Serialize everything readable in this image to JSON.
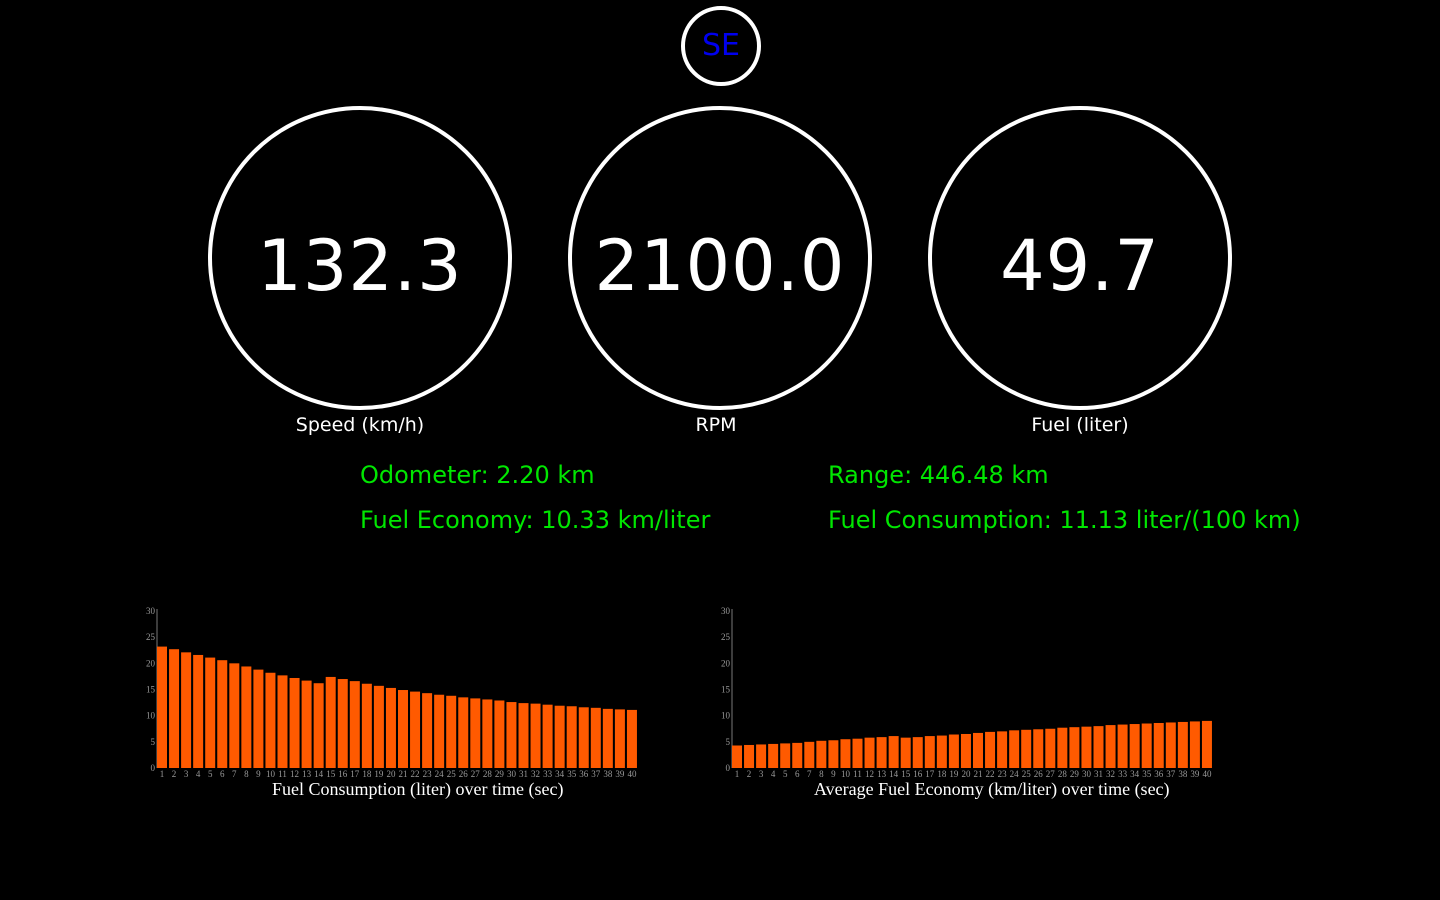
{
  "heading": {
    "text": "SE",
    "color": "#0000ee"
  },
  "gauges": {
    "speed": {
      "value": "132.3",
      "label": "Speed (km/h)"
    },
    "rpm": {
      "value": "2100.0",
      "label": "RPM"
    },
    "fuel": {
      "value": "49.7",
      "label": "Fuel (liter)"
    }
  },
  "stats": {
    "odometer": "Odometer: 2.20 km",
    "fuel_economy": "Fuel Economy: 10.33 km/liter",
    "range": "Range: 446.48 km",
    "fuel_consumption": "Fuel Consumption: 11.13 liter/(100 km)"
  },
  "colors": {
    "stat_text": "#00e600",
    "bars": "#ff5a00",
    "gauge_ring": "#ffffff",
    "background": "#000000"
  },
  "chart_data": [
    {
      "type": "bar",
      "title": "Fuel Consumption (liter) over time (sec)",
      "xlabel": "",
      "ylabel": "",
      "ylim": [
        0,
        30
      ],
      "yticks": [
        0,
        5,
        10,
        15,
        20,
        25,
        30
      ],
      "categories": [
        "1",
        "2",
        "3",
        "4",
        "5",
        "6",
        "7",
        "8",
        "9",
        "10",
        "11",
        "12",
        "13",
        "14",
        "15",
        "16",
        "17",
        "18",
        "19",
        "20",
        "21",
        "22",
        "23",
        "24",
        "25",
        "26",
        "27",
        "28",
        "29",
        "30",
        "31",
        "32",
        "33",
        "34",
        "35",
        "36",
        "37",
        "38",
        "39",
        "40"
      ],
      "values": [
        23.2,
        22.7,
        22.1,
        21.6,
        21.1,
        20.6,
        20.0,
        19.4,
        18.8,
        18.2,
        17.7,
        17.2,
        16.7,
        16.2,
        17.4,
        17.0,
        16.6,
        16.1,
        15.7,
        15.3,
        14.9,
        14.6,
        14.3,
        14.0,
        13.8,
        13.5,
        13.3,
        13.1,
        12.9,
        12.6,
        12.4,
        12.3,
        12.1,
        11.9,
        11.8,
        11.6,
        11.5,
        11.3,
        11.2,
        11.1
      ]
    },
    {
      "type": "bar",
      "title": "Average Fuel Economy (km/liter) over time (sec)",
      "xlabel": "",
      "ylabel": "",
      "ylim": [
        0,
        30
      ],
      "yticks": [
        0,
        5,
        10,
        15,
        20,
        25,
        30
      ],
      "categories": [
        "1",
        "2",
        "3",
        "4",
        "5",
        "6",
        "7",
        "8",
        "9",
        "10",
        "11",
        "12",
        "13",
        "14",
        "15",
        "16",
        "17",
        "18",
        "19",
        "20",
        "21",
        "22",
        "23",
        "24",
        "25",
        "26",
        "27",
        "28",
        "29",
        "30",
        "31",
        "32",
        "33",
        "34",
        "35",
        "36",
        "37",
        "38",
        "39",
        "40"
      ],
      "values": [
        4.3,
        4.4,
        4.5,
        4.6,
        4.7,
        4.8,
        5.0,
        5.2,
        5.3,
        5.5,
        5.6,
        5.8,
        5.9,
        6.1,
        5.8,
        5.9,
        6.1,
        6.2,
        6.4,
        6.5,
        6.7,
        6.9,
        7.0,
        7.2,
        7.3,
        7.4,
        7.5,
        7.7,
        7.8,
        7.9,
        8.0,
        8.2,
        8.3,
        8.4,
        8.5,
        8.6,
        8.7,
        8.8,
        8.9,
        9.0
      ]
    }
  ]
}
